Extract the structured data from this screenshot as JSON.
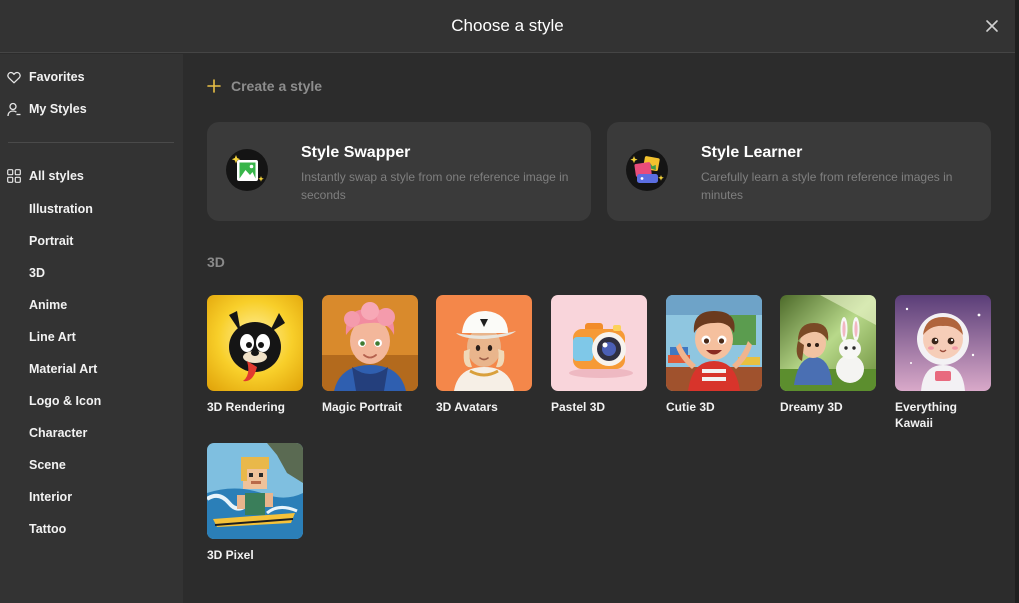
{
  "dialog": {
    "title": "Choose a style"
  },
  "sidebar": {
    "top_items": [
      {
        "label": "Favorites",
        "icon": "heart-icon"
      },
      {
        "label": "My Styles",
        "icon": "user-icon"
      }
    ],
    "all_styles": {
      "label": "All styles",
      "icon": "grid-icon"
    },
    "categories": [
      "Illustration",
      "Portrait",
      "3D",
      "Anime",
      "Line Art",
      "Material Art",
      "Logo & Icon",
      "Character",
      "Scene",
      "Interior",
      "Tattoo"
    ]
  },
  "main": {
    "create_label": "Create a style",
    "cards": [
      {
        "title": "Style Swapper",
        "description": "Instantly swap a style from one reference image in seconds"
      },
      {
        "title": "Style Learner",
        "description": "Carefully learn a style from reference images in minutes"
      }
    ],
    "section_title": "3D",
    "styles": [
      "3D Rendering",
      "Magic Portrait",
      "3D Avatars",
      "Pastel 3D",
      "Cutie 3D",
      "Dreamy 3D",
      "Everything Kawaii",
      "3D Pixel"
    ]
  },
  "colors": {
    "background": "#2c2c2c",
    "panel": "#333333",
    "card": "#3a3a3a",
    "accent": "#e9c046"
  }
}
